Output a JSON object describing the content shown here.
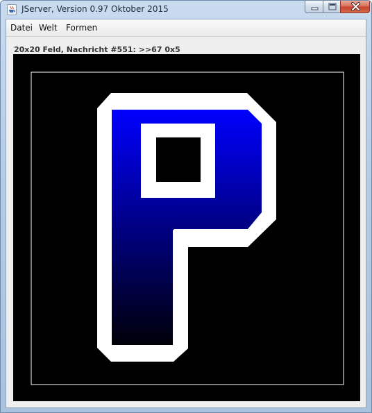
{
  "window": {
    "title": "JServer, Version 0.97 Oktober 2015",
    "icon": "java-cup-icon",
    "buttons": [
      "minimize-icon",
      "maximize-icon",
      "close-icon"
    ]
  },
  "menubar": {
    "items": [
      "Datei",
      "Welt",
      "Formen"
    ]
  },
  "status": {
    "text": "20x20 Feld, Nachricht #551: >>67 0x5"
  },
  "board": {
    "grid_size": "20x20",
    "background_color": "#000000",
    "frame_color": "#ffffff",
    "outline_color": "#ffffff",
    "gradient_top_color": "#0000ff",
    "gradient_bottom_color": "#000008",
    "shape": "letter-P"
  }
}
